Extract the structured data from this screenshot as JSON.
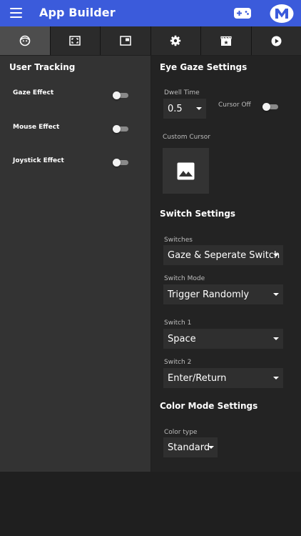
{
  "app": {
    "title": "App Builder"
  },
  "icons": {
    "menu": "menu-icon",
    "gamepad": "gamepad-icon",
    "logo": "m-logo-icon",
    "tabs": [
      "face-icon",
      "fullscreen-icon",
      "picture-in-picture-icon",
      "gear-icon",
      "movie-icon",
      "play-icon"
    ]
  },
  "colors": {
    "appbar": "#3b5bdb",
    "active_tab": "#4d4d4d",
    "left_panel": "#333333",
    "right_panel": "#232323"
  },
  "left": {
    "title": "User Tracking",
    "toggles": [
      {
        "label": "Gaze Effect",
        "on": false
      },
      {
        "label": "Mouse Effect",
        "on": false
      },
      {
        "label": "Joystick Effect",
        "on": false
      }
    ]
  },
  "eye_gaze": {
    "title": "Eye Gaze Settings",
    "dwell_label": "Dwell Time",
    "dwell_value": "0.5",
    "cursor_off_label": "Cursor Off",
    "cursor_off_on": false,
    "custom_cursor_label": "Custom Cursor"
  },
  "switch_settings": {
    "title": "Switch Settings",
    "switches_label": "Switches",
    "switches_value": "Gaze & Seperate Switch",
    "mode_label": "Switch Mode",
    "mode_value": "Trigger Randomly",
    "switch1_label": "Switch 1",
    "switch1_value": "Space",
    "switch2_label": "Switch 2",
    "switch2_value": "Enter/Return"
  },
  "color_mode": {
    "title": "Color Mode Settings",
    "type_label": "Color type",
    "type_value": "Standard"
  }
}
